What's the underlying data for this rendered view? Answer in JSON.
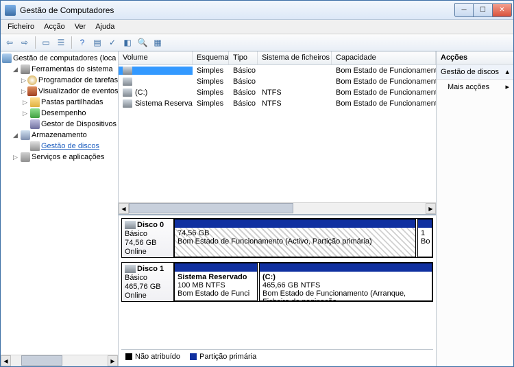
{
  "window": {
    "title": "Gestão de Computadores"
  },
  "menu": {
    "ficheiro": "Ficheiro",
    "accao": "Acção",
    "ver": "Ver",
    "ajuda": "Ajuda"
  },
  "tree": {
    "root": "Gestão de computadores (loca",
    "sys": "Ferramentas do sistema",
    "sched": "Programador de tarefas",
    "event": "Visualizador de eventos",
    "shared": "Pastas partilhadas",
    "perf": "Desempenho",
    "dev": "Gestor de Dispositivos",
    "storage": "Armazenamento",
    "diskmgmt": "Gestão de discos",
    "services": "Serviços e aplicações"
  },
  "columns": {
    "volume": "Volume",
    "esquema": "Esquema",
    "tipo": "Tipo",
    "sf": "Sistema de ficheiros",
    "cap": "Capacidade"
  },
  "volumes": [
    {
      "name": "",
      "esquema": "Simples",
      "tipo": "Básico",
      "sf": "",
      "cap": "Bom Estado de Funcionamento (Activo, Partiç"
    },
    {
      "name": "",
      "esquema": "Simples",
      "tipo": "Básico",
      "sf": "",
      "cap": "Bom Estado de Funcionamento (Partição prim"
    },
    {
      "name": "(C:)",
      "esquema": "Simples",
      "tipo": "Básico",
      "sf": "NTFS",
      "cap": "Bom Estado de Funcionamento (Arranque, Fi"
    },
    {
      "name": "Sistema Reservado",
      "esquema": "Simples",
      "tipo": "Básico",
      "sf": "NTFS",
      "cap": "Bom Estado de Funcionamento (Sistema, Act"
    }
  ],
  "disks": [
    {
      "label": "Disco 0",
      "type": "Básico",
      "size": "74,56 GB",
      "status": "Online",
      "parts": [
        {
          "title": "",
          "line1": "74,56 GB",
          "line2": "Bom Estado de Funcionamento (Activo, Partição primária)",
          "unalloc": true,
          "flex": "1"
        },
        {
          "title": "",
          "line1": "1",
          "line2": "Bo",
          "flex": "0 0 22px"
        }
      ]
    },
    {
      "label": "Disco 1",
      "type": "Básico",
      "size": "465,76 GB",
      "status": "Online",
      "parts": [
        {
          "title": "Sistema Reservado",
          "line1": "100 MB NTFS",
          "line2": "Bom Estado de Funci",
          "flex": "0 0 122px"
        },
        {
          "title": "(C:)",
          "line1": "465,66 GB NTFS",
          "line2": "Bom Estado de Funcionamento (Arranque, Ficheiro de paginação,",
          "flex": "1"
        }
      ]
    }
  ],
  "legend": {
    "unalloc": "Não atribuído",
    "primary": "Partição primária"
  },
  "actions": {
    "header": "Acções",
    "section": "Gestão de discos",
    "more": "Mais acções"
  }
}
